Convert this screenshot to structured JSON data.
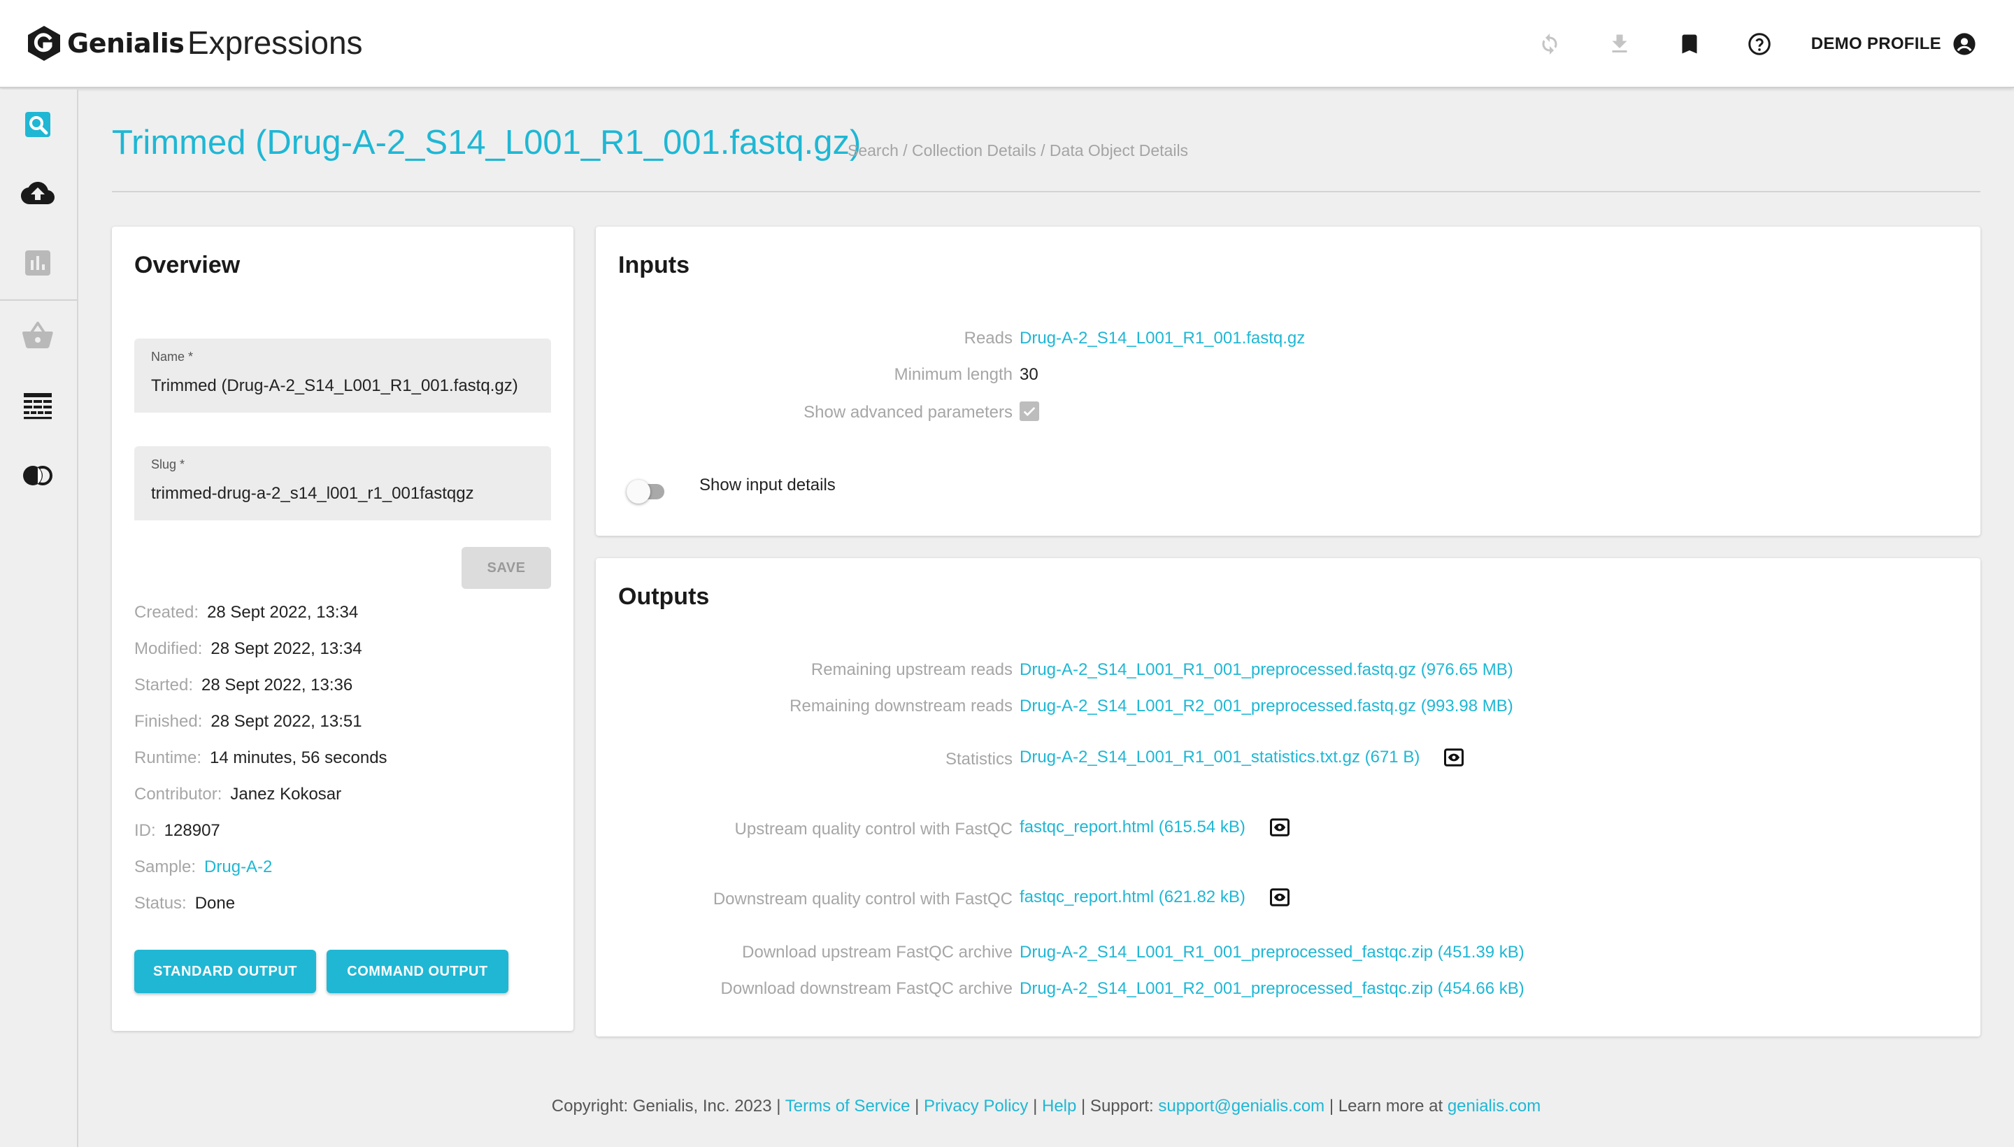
{
  "topbar": {
    "brand": "Genialis",
    "app_title": "Expressions",
    "profile_label": "DEMO PROFILE",
    "icons": [
      "refresh-icon",
      "download-icon",
      "bookmark-icon",
      "help-icon",
      "account-icon"
    ]
  },
  "sidebar": {
    "items": [
      "search-icon",
      "upload-cloud-icon",
      "chart-icon",
      "basket-icon",
      "table-icon",
      "compare-icon"
    ],
    "active": "search-icon"
  },
  "header": {
    "title": "Trimmed (Drug-A-2_S14_L001_R1_001.fastq.gz)",
    "breadcrumb": [
      "Search",
      "Collection Details",
      "Data Object Details"
    ]
  },
  "overview": {
    "title": "Overview",
    "name_label": "Name *",
    "name_value": "Trimmed (Drug-A-2_S14_L001_R1_001.fastq.gz)",
    "slug_label": "Slug *",
    "slug_value": "trimmed-drug-a-2_s14_l001_r1_001fastqgz",
    "save_label": "SAVE",
    "meta": [
      {
        "key": "Created:",
        "value": "28 Sept 2022, 13:34"
      },
      {
        "key": "Modified:",
        "value": "28 Sept 2022, 13:34"
      },
      {
        "key": "Started:",
        "value": "28 Sept 2022, 13:36"
      },
      {
        "key": "Finished:",
        "value": "28 Sept 2022, 13:51"
      },
      {
        "key": "Runtime:",
        "value": "14 minutes, 56 seconds"
      },
      {
        "key": "Contributor:",
        "value": "Janez Kokosar"
      },
      {
        "key": "ID:",
        "value": "128907"
      },
      {
        "key": "Sample:",
        "value": "Drug-A-2"
      },
      {
        "key": "Status:",
        "value": "Done"
      }
    ],
    "standard_output_label": "STANDARD OUTPUT",
    "command_output_label": "COMMAND OUTPUT"
  },
  "inputs": {
    "title": "Inputs",
    "rows": [
      {
        "key": "Reads",
        "value": "Drug-A-2_S14_L001_R1_001.fastq.gz"
      },
      {
        "key": "Minimum length",
        "value": "30"
      },
      {
        "key": "Show advanced parameters",
        "value": "checked"
      }
    ],
    "toggle_label": "Show input details",
    "toggle_on": false
  },
  "outputs": {
    "title": "Outputs",
    "rows": [
      {
        "key": "Remaining upstream reads",
        "value": "Drug-A-2_S14_L001_R1_001_preprocessed.fastq.gz (976.65 MB)"
      },
      {
        "key": "Remaining downstream reads",
        "value": "Drug-A-2_S14_L001_R2_001_preprocessed.fastq.gz (993.98 MB)"
      },
      {
        "key": "Statistics",
        "value": "Drug-A-2_S14_L001_R1_001_statistics.txt.gz (671 B)"
      },
      {
        "key": "Upstream quality control with FastQC",
        "value": "fastqc_report.html (615.54 kB)"
      },
      {
        "key": "Downstream quality control with FastQC",
        "value": "fastqc_report.html (621.82 kB)"
      },
      {
        "key": "Download upstream FastQC archive",
        "value": "Drug-A-2_S14_L001_R1_001_preprocessed_fastqc.zip (451.39 kB)"
      },
      {
        "key": "Download downstream FastQC archive",
        "value": "Drug-A-2_S14_L001_R2_001_preprocessed_fastqc.zip (454.66 kB)"
      }
    ]
  },
  "footer": {
    "copyright": "Copyright: Genialis, Inc. 2023 |",
    "terms": "Terms of Service",
    "sep1": "|",
    "privacy": "Privacy Policy",
    "sep2": "|",
    "help": "Help",
    "support_prefix": "| Support:",
    "support_email": "support@genialis.com",
    "learn_prefix": "| Learn more at",
    "site": "genialis.com"
  },
  "colors": {
    "accent": "#1fb7d4",
    "muted": "#a6a6a6",
    "background": "#efefef"
  }
}
